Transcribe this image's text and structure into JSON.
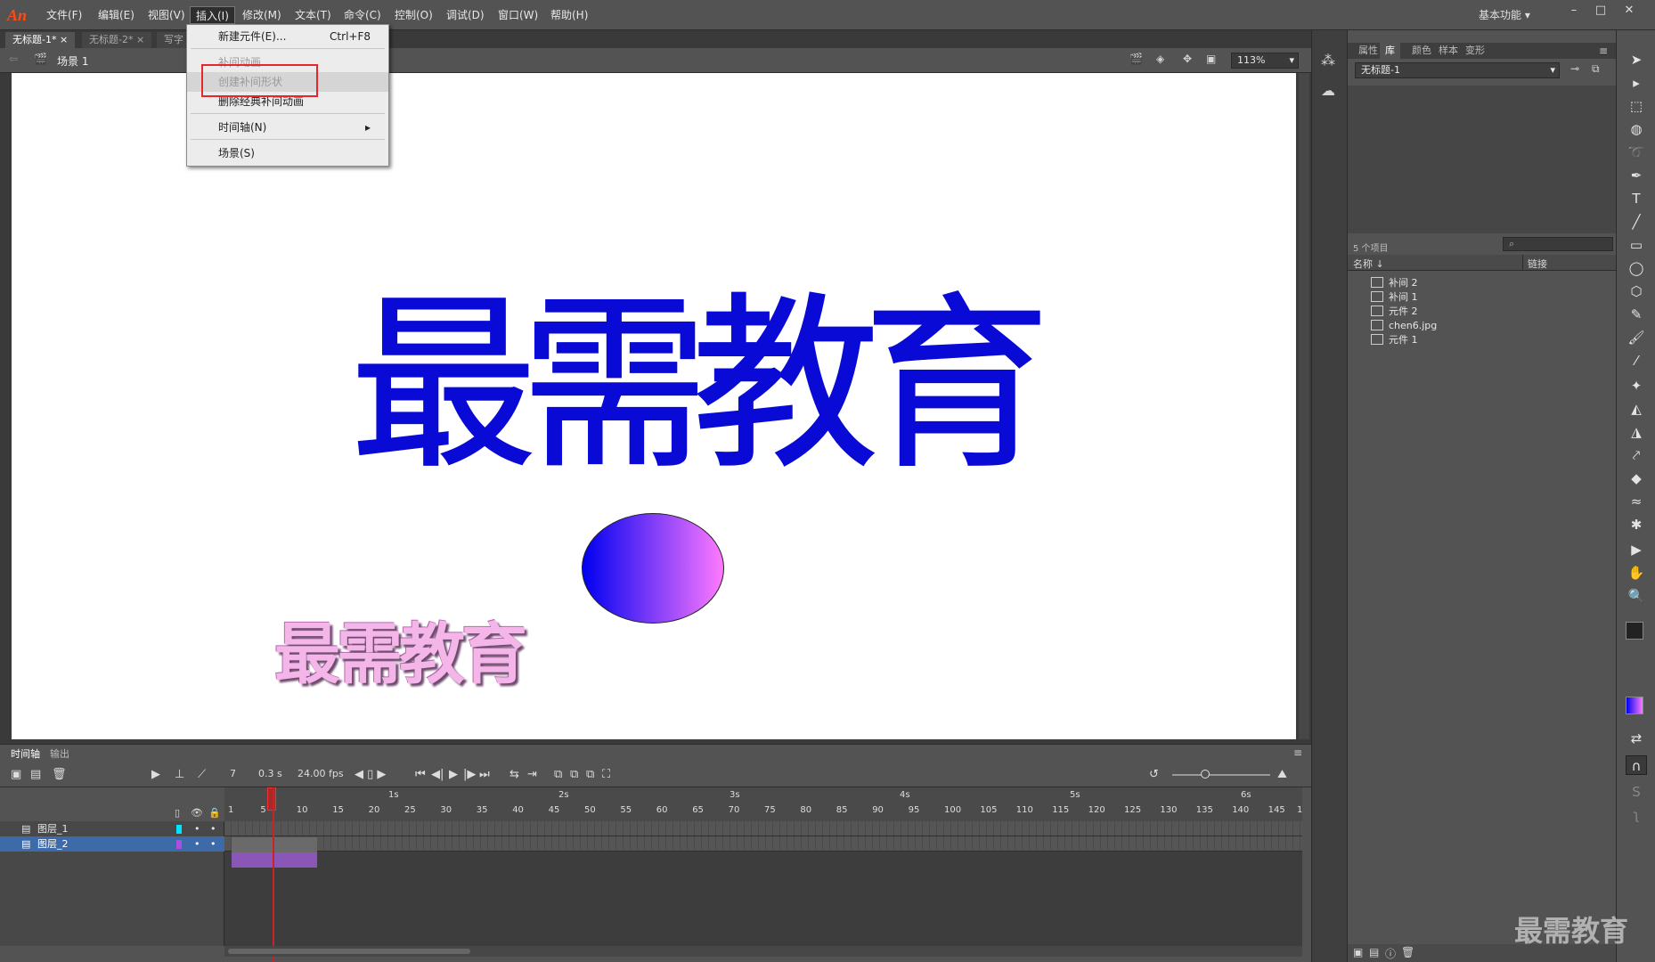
{
  "app": {
    "logo": "An",
    "workspace": "基本功能"
  },
  "menu": [
    "文件(F)",
    "编辑(E)",
    "视图(V)",
    "插入(I)",
    "修改(M)",
    "文本(T)",
    "命令(C)",
    "控制(O)",
    "调试(D)",
    "窗口(W)",
    "帮助(H)"
  ],
  "tabs": [
    "无标题-1*",
    "无标题-2*",
    "写字"
  ],
  "scene": {
    "label": "场景 1",
    "zoom": "113%"
  },
  "insert_menu": {
    "items": [
      {
        "label": "新建元件(E)...",
        "shortcut": "Ctrl+F8",
        "state": "normal"
      },
      {
        "label": "补间动画",
        "shortcut": "",
        "state": "disabled"
      },
      {
        "label": "创建补间形状",
        "shortcut": "",
        "state": "highlighted-disabled"
      },
      {
        "label": "删除经典补间动画",
        "shortcut": "",
        "state": "normal"
      },
      {
        "label": "时间轴(N)",
        "shortcut": "▸",
        "state": "normal"
      },
      {
        "label": "场景(S)",
        "shortcut": "",
        "state": "normal"
      }
    ]
  },
  "stage": {
    "big_text": "最需教育",
    "small_text": "最需教育",
    "ellipse_gradient": [
      "#0000f0",
      "#ff7aff"
    ],
    "text_color": "#0a0ad6"
  },
  "properties_tabs": [
    "属性",
    "库",
    "颜色",
    "样本",
    "变形"
  ],
  "library": {
    "document": "无标题-1",
    "count": "5 个项目",
    "col_name": "名称",
    "col_link": "链接",
    "items": [
      {
        "name": "补间 2",
        "icon": "graphic-icon"
      },
      {
        "name": "补间 1",
        "icon": "graphic-icon"
      },
      {
        "name": "元件 2",
        "icon": "movieclip-icon"
      },
      {
        "name": "chen6.jpg",
        "icon": "bitmap-icon"
      },
      {
        "name": "元件 1",
        "icon": "movieclip-icon"
      }
    ]
  },
  "timeline": {
    "tabs": [
      "时间轴",
      "输出"
    ],
    "current_frame": "7",
    "time": "0.3 s",
    "fps": "24.00 fps",
    "layers": [
      {
        "name": "图层_1",
        "color": "#00e5ff",
        "selected": false
      },
      {
        "name": "图层_2",
        "color": "#b14ce0",
        "selected": true
      }
    ],
    "frame_ticks": [
      "1",
      "5",
      "10",
      "15",
      "20",
      "25",
      "30",
      "35",
      "40",
      "45",
      "50",
      "55",
      "60",
      "65",
      "70",
      "75",
      "80",
      "85",
      "90",
      "95",
      "100",
      "105",
      "110",
      "115",
      "120",
      "125",
      "130",
      "135",
      "140",
      "145",
      "1"
    ],
    "seconds": [
      "1s",
      "2s",
      "3s",
      "4s",
      "5s",
      "6s"
    ]
  },
  "watermark": "最需教育"
}
